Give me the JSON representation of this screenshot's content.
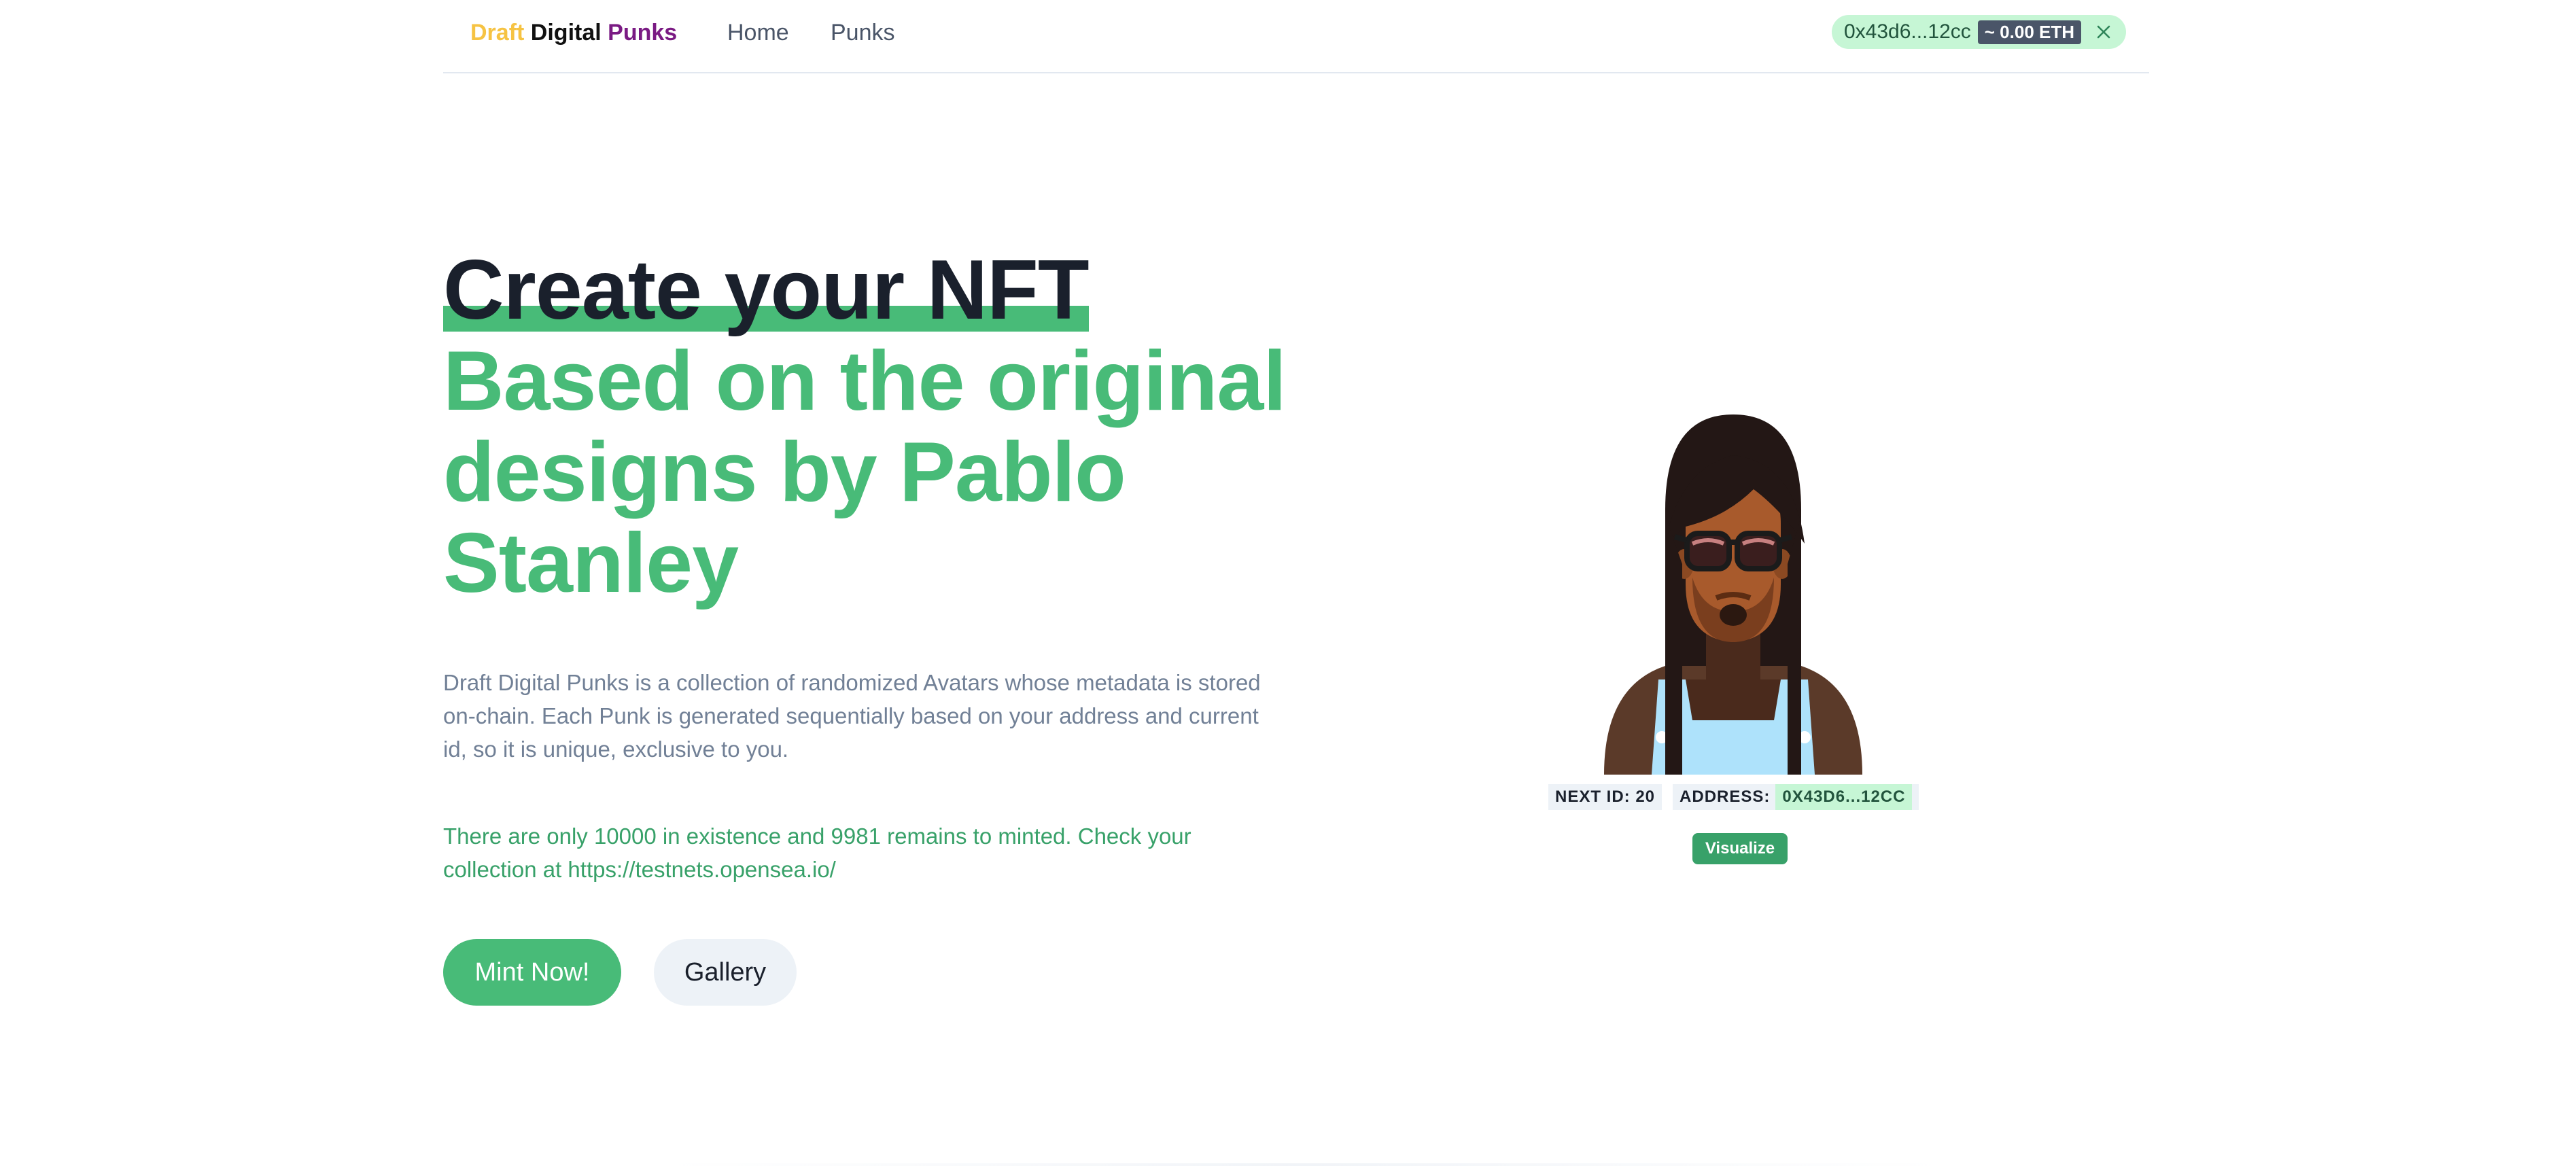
{
  "nav": {
    "brand_part1": "Draft",
    "brand_part2": "Digital",
    "brand_part3": "Punks",
    "links": [
      {
        "label": "Home"
      },
      {
        "label": "Punks"
      }
    ],
    "wallet": {
      "address": "0x43d6...12cc",
      "balance": "~ 0.00 ETH",
      "close_icon": "close-icon"
    }
  },
  "hero": {
    "title_line1": "Create your NFT",
    "title_line2": "Based on the original designs by Pablo Stanley",
    "description": "Draft Digital Punks is a collection of randomized Avatars whose metadata is stored on-chain. Each Punk is generated sequentially based on your address and current id, so it is unique, exclusive to you.",
    "supply_note": "There are only 10000 in existence and 9981 remains to minted. Check your collection at https://testnets.opensea.io/",
    "mint_button": "Mint Now!",
    "gallery_button": "Gallery"
  },
  "preview": {
    "next_id_label": "NEXT ID: 20",
    "address_label": "ADDRESS:",
    "address_value": "0X43D6...12CC",
    "visualize_button": "Visualize"
  },
  "colors": {
    "brand_yellow": "#f6c343",
    "brand_purple": "#7a1a83",
    "accent_green": "#48bb78",
    "muted_text": "#718096"
  }
}
